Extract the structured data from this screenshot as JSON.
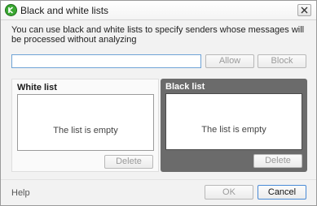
{
  "window": {
    "title": "Black and white lists",
    "icon": "kaspersky-k-icon",
    "close_icon": "close-icon"
  },
  "description": "You can use black and white lists to specify senders whose messages will be processed without analyzing",
  "address_input": {
    "value": "",
    "placeholder": ""
  },
  "allow_button": {
    "label": "Allow",
    "enabled": false
  },
  "block_button": {
    "label": "Block",
    "enabled": false
  },
  "white_list": {
    "title": "White list",
    "empty_text": "The list is empty",
    "delete_label": "Delete"
  },
  "black_list": {
    "title": "Black list",
    "empty_text": "The list is empty",
    "delete_label": "Delete"
  },
  "footer": {
    "help_label": "Help",
    "ok_label": "OK",
    "cancel_label": "Cancel"
  },
  "colors": {
    "app_icon": "#3aa832",
    "black_panel": "#6b6b6b",
    "focus_border": "#6fa3d6"
  }
}
